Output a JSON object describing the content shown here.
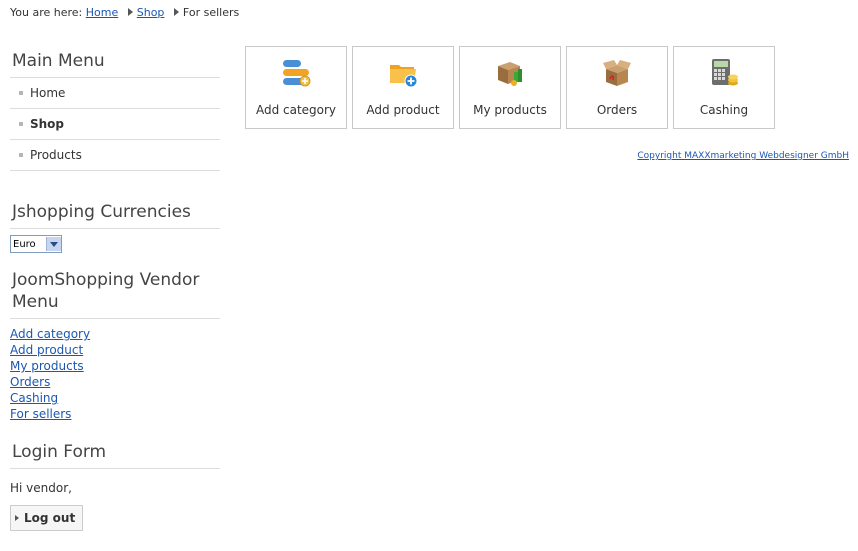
{
  "breadcrumb": {
    "prefix": "You are here:",
    "items": [
      "Home",
      "Shop",
      "For sellers"
    ]
  },
  "main_menu": {
    "title": "Main Menu",
    "items": [
      {
        "label": "Home",
        "active": false
      },
      {
        "label": "Shop",
        "active": true
      },
      {
        "label": "Products",
        "active": false
      }
    ]
  },
  "currencies": {
    "title": "Jshopping Currencies",
    "selected": "Euro"
  },
  "vendor_menu": {
    "title": "JoomShopping Vendor Menu",
    "links": [
      "Add category",
      "Add product",
      "My products",
      "Orders",
      "Cashing",
      "For sellers"
    ]
  },
  "login_form": {
    "title": "Login Form",
    "greeting": "Hi vendor,",
    "logout_label": "Log out"
  },
  "tiles": [
    {
      "label": "Add category",
      "icon": "add-category-icon"
    },
    {
      "label": "Add product",
      "icon": "add-product-icon"
    },
    {
      "label": "My products",
      "icon": "my-products-icon"
    },
    {
      "label": "Orders",
      "icon": "orders-icon"
    },
    {
      "label": "Cashing",
      "icon": "cashing-icon"
    }
  ],
  "footer": {
    "copyright": "Copyright MAXXmarketing Webdesigner GmbH"
  },
  "colors": {
    "link": "#1b57b1",
    "border": "#dddddd",
    "tile_border": "#c9c9c9"
  }
}
